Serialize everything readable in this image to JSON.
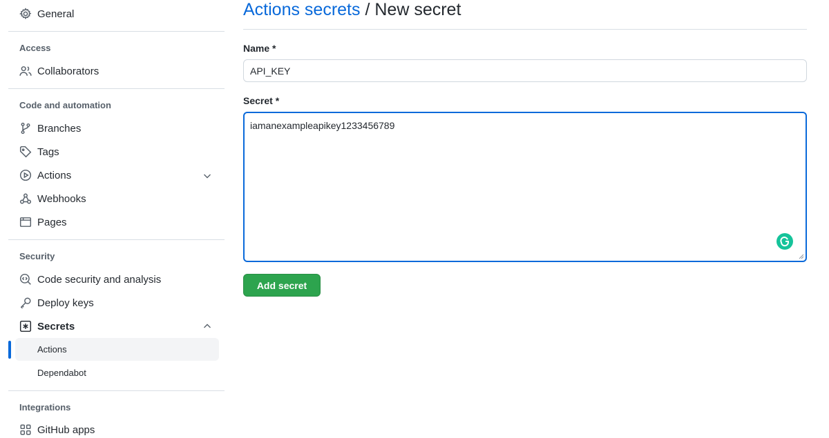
{
  "sidebar": {
    "general": {
      "label": "General",
      "icon": "gear-icon"
    },
    "access": {
      "title": "Access",
      "collaborators": {
        "label": "Collaborators",
        "icon": "people-icon"
      }
    },
    "code_automation": {
      "title": "Code and automation",
      "branches": {
        "label": "Branches",
        "icon": "git-branch-icon"
      },
      "tags": {
        "label": "Tags",
        "icon": "tag-icon"
      },
      "actions": {
        "label": "Actions",
        "icon": "play-icon"
      },
      "webhooks": {
        "label": "Webhooks",
        "icon": "webhook-icon"
      },
      "pages": {
        "label": "Pages",
        "icon": "browser-icon"
      }
    },
    "security": {
      "title": "Security",
      "code_security": {
        "label": "Code security and analysis",
        "icon": "codescan-icon"
      },
      "deploy_keys": {
        "label": "Deploy keys",
        "icon": "key-icon"
      },
      "secrets": {
        "label": "Secrets",
        "icon": "asterisk-icon"
      },
      "secrets_sub": [
        {
          "label": "Actions",
          "active": true
        },
        {
          "label": "Dependabot",
          "active": false
        }
      ]
    },
    "integrations": {
      "title": "Integrations",
      "github_apps": {
        "label": "GitHub apps",
        "icon": "apps-icon"
      }
    }
  },
  "main": {
    "breadcrumb_link": "Actions secrets",
    "breadcrumb_sep": " / ",
    "breadcrumb_current": "New secret",
    "name_label": "Name *",
    "name_value": "API_KEY",
    "secret_label": "Secret *",
    "secret_value": "iamanexampleapikey1233456789",
    "add_button": "Add secret"
  },
  "colors": {
    "accent": "#0969da",
    "button_green": "#2da44e",
    "grammarly": "#15c39a"
  }
}
